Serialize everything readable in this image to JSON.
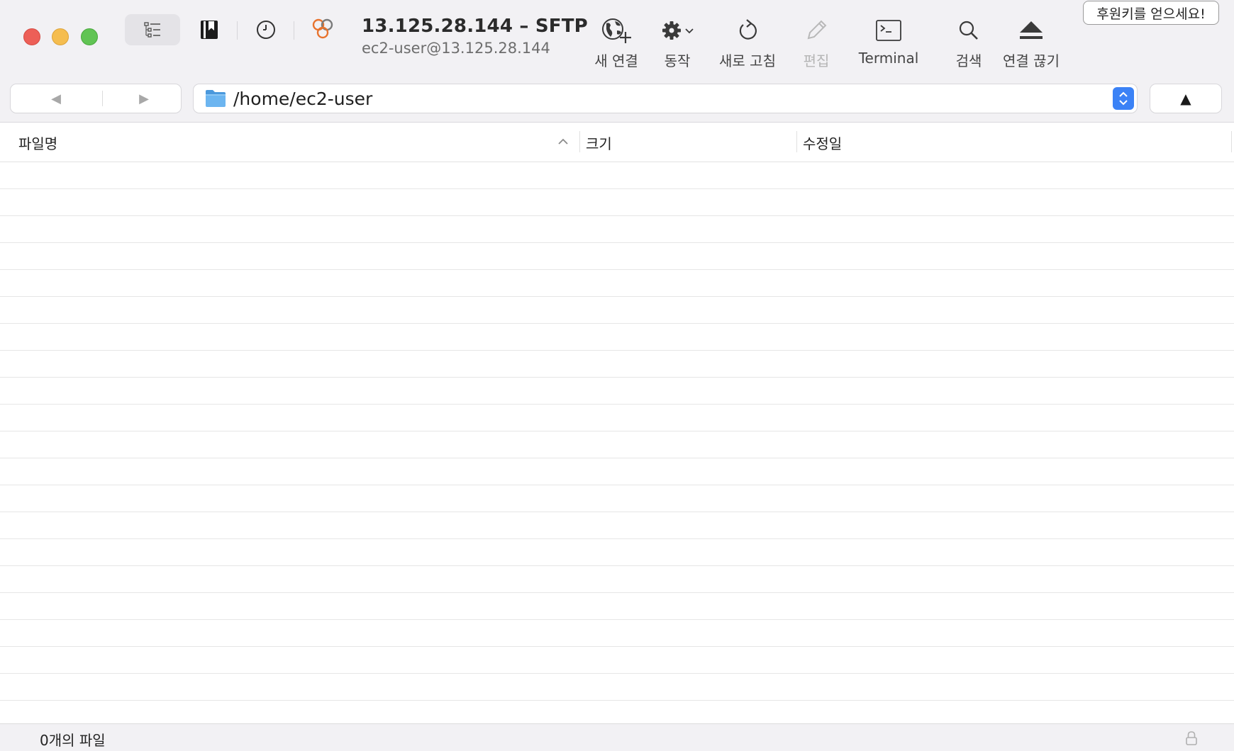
{
  "window": {
    "title": "13.125.28.144 – SFTP",
    "subtitle": "ec2-user@13.125.28.144"
  },
  "toolbar": {
    "new_connection": "새 연결",
    "action": "동작",
    "refresh": "새로 고침",
    "edit": "편집",
    "terminal": "Terminal",
    "search": "검색",
    "disconnect": "연결 끊기",
    "donate": "후원키를 얻으세요!"
  },
  "navbar": {
    "back_glyph": "◀",
    "forward_glyph": "▶",
    "path": "/home/ec2-user",
    "up_glyph": "▲"
  },
  "table": {
    "columns": [
      "파일명",
      "크기",
      "수정일"
    ],
    "sort_column": "파일명",
    "sort_direction": "ascending",
    "rows": []
  },
  "status": {
    "file_count": "0개의 파일"
  },
  "colors": {
    "close": "#ed5f57",
    "minimize": "#f5bd4f",
    "zoom": "#61c454",
    "accent": "#3b82f6",
    "folder": "#5aa7e8"
  }
}
